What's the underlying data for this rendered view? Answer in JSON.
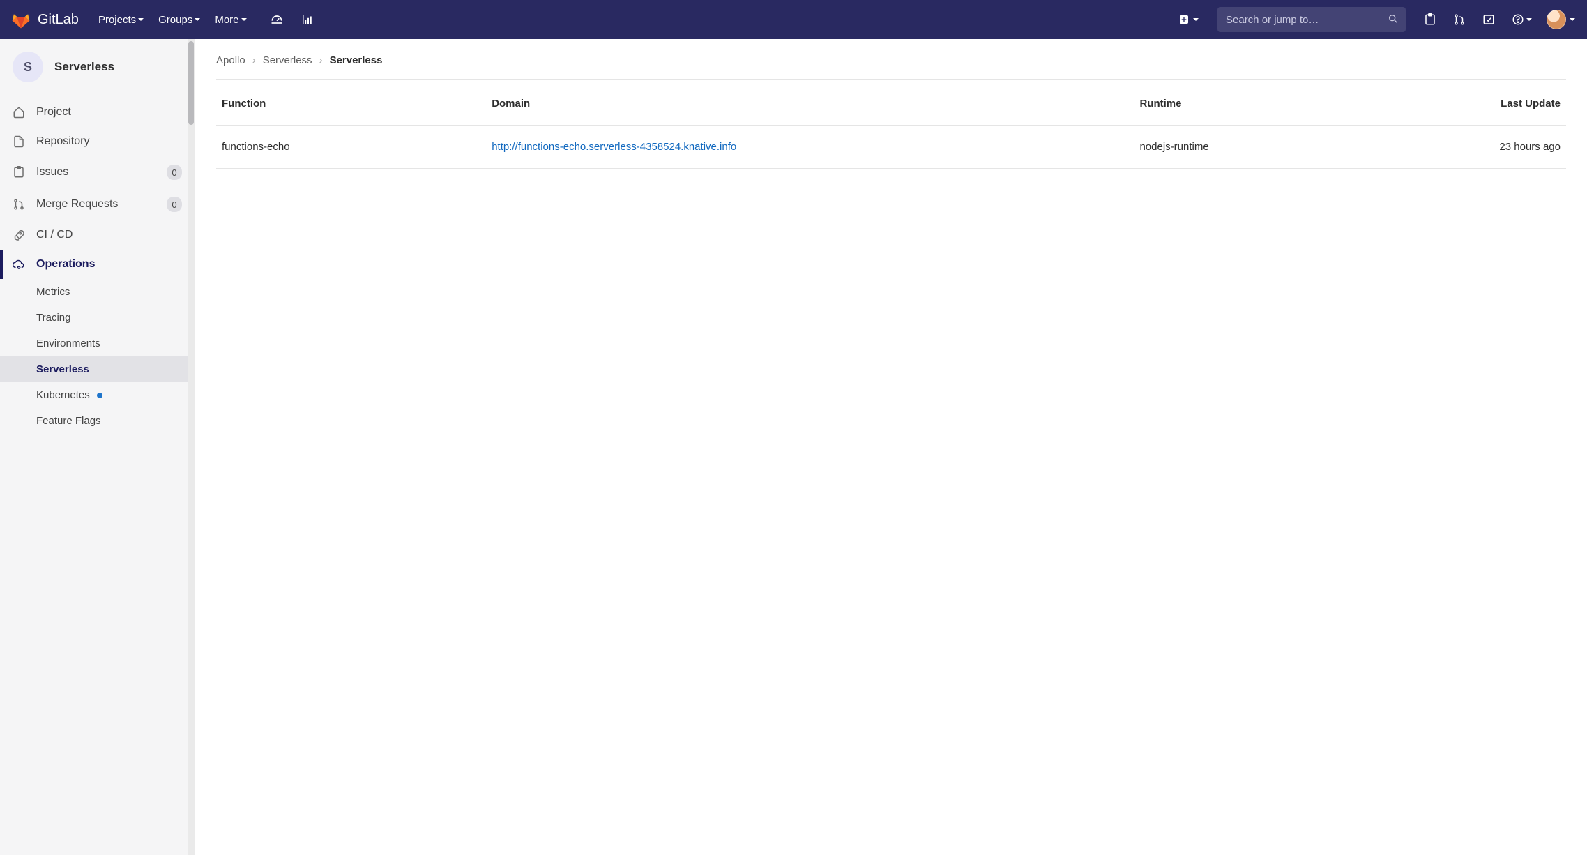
{
  "brand": "GitLab",
  "header": {
    "nav": [
      {
        "label": "Projects"
      },
      {
        "label": "Groups"
      },
      {
        "label": "More"
      }
    ],
    "search_placeholder": "Search or jump to…"
  },
  "project": {
    "initial": "S",
    "name": "Serverless"
  },
  "sidebar": {
    "items": [
      {
        "label": "Project",
        "icon": "home-icon"
      },
      {
        "label": "Repository",
        "icon": "file-icon"
      },
      {
        "label": "Issues",
        "icon": "issues-icon",
        "badge": "0"
      },
      {
        "label": "Merge Requests",
        "icon": "merge-icon",
        "badge": "0"
      },
      {
        "label": "CI / CD",
        "icon": "rocket-icon"
      },
      {
        "label": "Operations",
        "icon": "cloud-gear-icon",
        "active_section": true,
        "children": [
          {
            "label": "Metrics"
          },
          {
            "label": "Tracing"
          },
          {
            "label": "Environments"
          },
          {
            "label": "Serverless",
            "active": true
          },
          {
            "label": "Kubernetes",
            "dot": true
          },
          {
            "label": "Feature Flags"
          }
        ]
      }
    ]
  },
  "breadcrumb": {
    "items": [
      "Apollo",
      "Serverless"
    ],
    "current": "Serverless"
  },
  "table": {
    "headers": [
      "Function",
      "Domain",
      "Runtime",
      "Last Update"
    ],
    "rows": [
      {
        "function": "functions-echo",
        "domain": "http://functions-echo.serverless-4358524.knative.info",
        "runtime": "nodejs-runtime",
        "updated": "23 hours ago"
      }
    ]
  }
}
